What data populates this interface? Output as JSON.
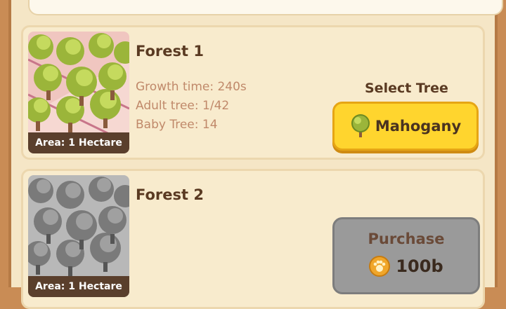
{
  "forests": [
    {
      "title": "Forest 1",
      "area": "Area: 1 Hectare",
      "growth_time": "Growth time: 240s",
      "adult_tree": "Adult tree: 1/42",
      "baby_tree": "Baby Tree: 14",
      "select_label": "Select Tree",
      "tree_button": "Mahogany",
      "tree_icon": "tree-icon"
    },
    {
      "title": "Forest 2",
      "area": "Area: 1 Hectare",
      "purchase_label": "Purchase",
      "price": "100b",
      "coin_icon": "paw-coin-icon",
      "locked": true
    }
  ],
  "colors": {
    "accent": "#ffd52e",
    "card_bg": "#f8ebcd",
    "stat_text": "#c0896a",
    "title_text": "#5a3a22"
  }
}
